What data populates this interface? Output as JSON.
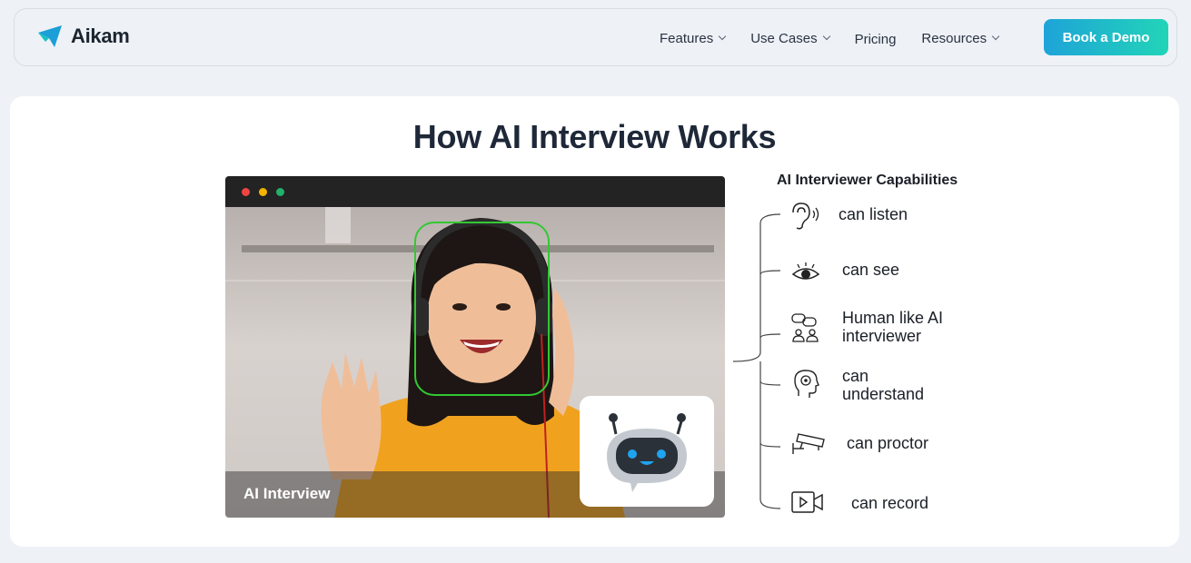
{
  "brand": {
    "name": "Aikam",
    "accent_start": "#1ea4d8",
    "accent_end": "#22d4b8"
  },
  "nav": {
    "items": [
      {
        "label": "Features",
        "dropdown": true
      },
      {
        "label": "Use Cases",
        "dropdown": true
      },
      {
        "label": "Pricing",
        "dropdown": false
      },
      {
        "label": "Resources",
        "dropdown": true
      }
    ],
    "cta_label": "Book a Demo"
  },
  "main": {
    "title": "How AI Interview Works",
    "video": {
      "label": "AI Interview",
      "face_box_color": "#32c832"
    },
    "capabilities": {
      "title": "AI Interviewer Capabilities",
      "items": [
        {
          "label": "can listen",
          "icon": "ear-icon"
        },
        {
          "label": "can see",
          "icon": "eye-icon"
        },
        {
          "label": "Human like AI interviewer",
          "icon": "people-chat-icon"
        },
        {
          "label": "can understand",
          "icon": "brain-gear-icon"
        },
        {
          "label": "can proctor",
          "icon": "cctv-camera-icon"
        },
        {
          "label": "can record",
          "icon": "video-record-icon"
        }
      ]
    }
  }
}
